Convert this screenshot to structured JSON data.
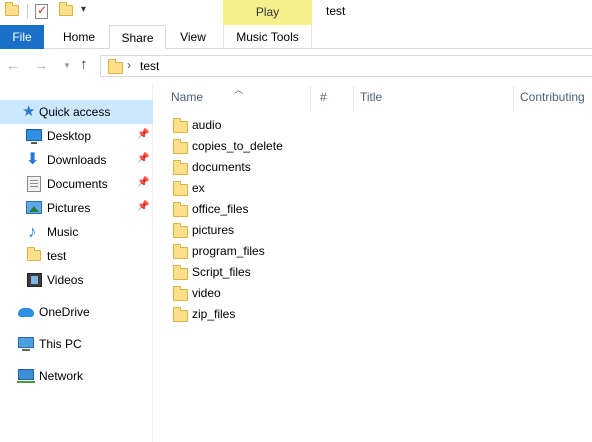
{
  "window": {
    "title": "test",
    "context_tab_header": "Play"
  },
  "ribbon": {
    "tabs": [
      {
        "label": "File"
      },
      {
        "label": "Home"
      },
      {
        "label": "Share"
      },
      {
        "label": "View"
      },
      {
        "label": "Music Tools"
      }
    ]
  },
  "address": {
    "breadcrumb": "test"
  },
  "navigation": {
    "items": [
      {
        "label": "Quick access",
        "icon": "star-icon",
        "pinned": false,
        "selected": true
      },
      {
        "label": "Desktop",
        "icon": "desktop-icon",
        "pinned": true
      },
      {
        "label": "Downloads",
        "icon": "downloads-icon",
        "pinned": true
      },
      {
        "label": "Documents",
        "icon": "documents-icon",
        "pinned": true
      },
      {
        "label": "Pictures",
        "icon": "pictures-icon",
        "pinned": true
      },
      {
        "label": "Music",
        "icon": "music-icon",
        "pinned": false
      },
      {
        "label": "test",
        "icon": "folder-icon",
        "pinned": false
      },
      {
        "label": "Videos",
        "icon": "videos-icon",
        "pinned": false
      },
      {
        "label": "OneDrive",
        "icon": "onedrive-icon",
        "pinned": false
      },
      {
        "label": "This PC",
        "icon": "this-pc-icon",
        "pinned": false
      },
      {
        "label": "Network",
        "icon": "network-icon",
        "pinned": false
      }
    ]
  },
  "columns": {
    "name": "Name",
    "number": "#",
    "title": "Title",
    "contributing": "Contributing"
  },
  "files": [
    {
      "name": "audio",
      "type": "folder"
    },
    {
      "name": "copies_to_delete",
      "type": "folder"
    },
    {
      "name": "documents",
      "type": "folder"
    },
    {
      "name": "ex",
      "type": "folder"
    },
    {
      "name": "office_files",
      "type": "folder"
    },
    {
      "name": "pictures",
      "type": "folder"
    },
    {
      "name": "program_files",
      "type": "folder"
    },
    {
      "name": "Script_files",
      "type": "folder"
    },
    {
      "name": "video",
      "type": "folder"
    },
    {
      "name": "zip_files",
      "type": "folder"
    }
  ],
  "colors": {
    "file_tab": "#1a6fc7",
    "context_tab": "#f5f08c",
    "selected_nav": "#cce8ff",
    "folder": "#ffe08a",
    "column_header_text": "#4c607a"
  }
}
